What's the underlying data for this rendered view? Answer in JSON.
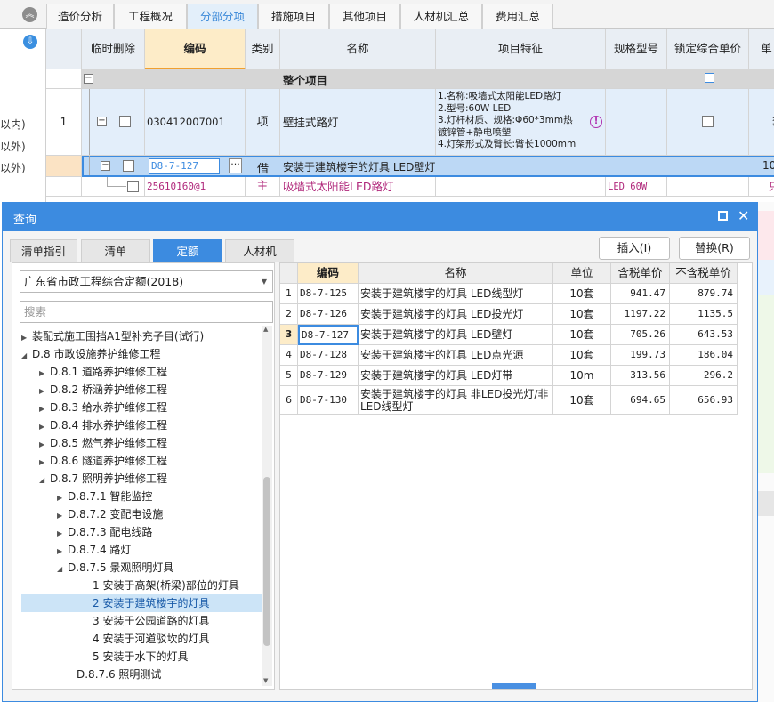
{
  "top_tabs": [
    "造价分析",
    "工程概况",
    "分部分项",
    "措施项目",
    "其他项目",
    "人材机汇总",
    "费用汇总"
  ],
  "left_strip": [
    "以内)",
    "以外)",
    "以外)"
  ],
  "grid": {
    "headers": [
      "临时删除",
      "编码",
      "类别",
      "名称",
      "项目特征",
      "规格型号",
      "锁定综合单价",
      "单"
    ],
    "group_row": {
      "name": "整个项目"
    },
    "row1": {
      "num": "1",
      "code": "030412007001",
      "type": "项",
      "name": "壁挂式路灯",
      "features": [
        "1.名称:吸墙式太阳能LED路灯",
        "2.型号:60W LED",
        "3.灯杆材质、规格:Φ60*3mm热",
        "镀锌管+静电喷塑",
        "4.灯架形式及臂长:臂长1000mm"
      ],
      "unit_partial": "套"
    },
    "row2": {
      "code": "D8-7-127",
      "type": "借",
      "name": "安装于建筑楼宇的灯具 LED壁灯",
      "unit_partial": "10"
    },
    "row3": {
      "code": "25610160@1",
      "type": "主",
      "name": "吸墙式太阳能LED路灯",
      "spec": "LED 60W",
      "unit_partial": "只"
    }
  },
  "dialog": {
    "title": "查询",
    "tabs": [
      "清单指引",
      "清单",
      "定额",
      "人材机"
    ],
    "active_tab": "定额",
    "insert_label": "插入(I)",
    "replace_label": "替换(R)",
    "library": "广东省市政工程综合定额(2018)",
    "search_placeholder": "搜索",
    "tree": [
      "装配式施工围挡A1型补充子目(试行)",
      "D.8 市政设施养护维修工程",
      "D.8.1 道路养护维修工程",
      "D.8.2 桥涵养护维修工程",
      "D.8.3 给水养护维修工程",
      "D.8.4 排水养护维修工程",
      "D.8.5 燃气养护维修工程",
      "D.8.6 隧道养护维修工程",
      "D.8.7 照明养护维修工程",
      "D.8.7.1 智能监控",
      "D.8.7.2 变配电设施",
      "D.8.7.3 配电线路",
      "D.8.7.4 路灯",
      "D.8.7.5 景观照明灯具",
      "1 安装于高架(桥梁)部位的灯具",
      "2 安装于建筑楼宇的灯具",
      "3 安装于公园道路的灯具",
      "4 安装于河道驳坎的灯具",
      "5 安装于水下的灯具",
      "D.8.7.6 照明测试"
    ],
    "table_headers": [
      "编码",
      "名称",
      "单位",
      "含税单价",
      "不含税单价"
    ],
    "rows": [
      {
        "n": "1",
        "code": "D8-7-125",
        "name": "安装于建筑楼宇的灯具 LED线型灯",
        "unit": "10套",
        "tax": "941.47",
        "notax": "879.74"
      },
      {
        "n": "2",
        "code": "D8-7-126",
        "name": "安装于建筑楼宇的灯具 LED投光灯",
        "unit": "10套",
        "tax": "1197.22",
        "notax": "1135.5"
      },
      {
        "n": "3",
        "code": "D8-7-127",
        "name": "安装于建筑楼宇的灯具 LED壁灯",
        "unit": "10套",
        "tax": "705.26",
        "notax": "643.53"
      },
      {
        "n": "4",
        "code": "D8-7-128",
        "name": "安装于建筑楼宇的灯具 LED点光源",
        "unit": "10套",
        "tax": "199.73",
        "notax": "186.04"
      },
      {
        "n": "5",
        "code": "D8-7-129",
        "name": "安装于建筑楼宇的灯具 LED灯带",
        "unit": "10m",
        "tax": "313.56",
        "notax": "296.2"
      },
      {
        "n": "6",
        "code": "D8-7-130",
        "name": "安装于建筑楼宇的灯具 非LED投光灯/非LED线型灯",
        "unit": "10套",
        "tax": "694.65",
        "notax": "656.93"
      }
    ]
  },
  "colors": {
    "accent": "#3c8be0",
    "selected_row": "#bcd8f5",
    "main_text": "#b0287b"
  }
}
